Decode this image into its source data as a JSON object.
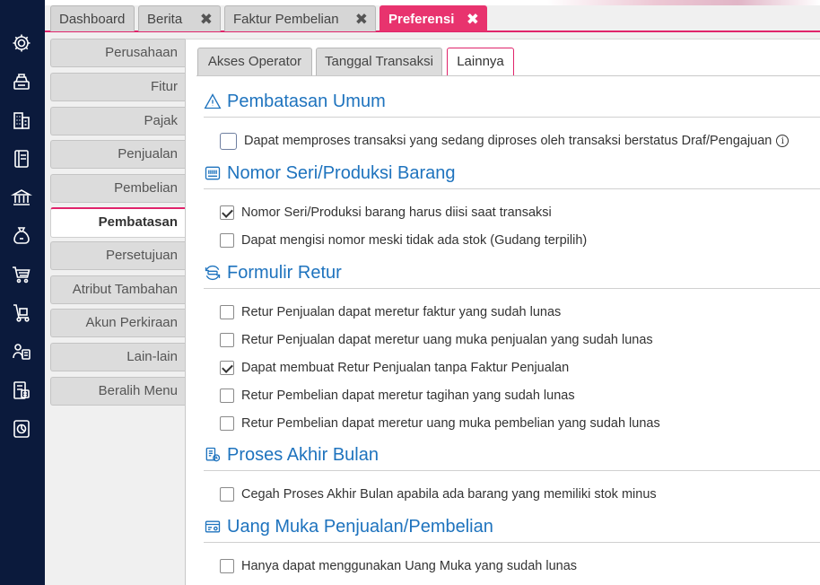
{
  "nav_icons": [
    "gear-icon",
    "cash-register-icon",
    "building-icon",
    "book-icon",
    "bank-icon",
    "money-bag-icon",
    "cart-icon",
    "hand-truck-icon",
    "accounting-icon",
    "tax-icon",
    "report-chart-icon"
  ],
  "tabs": [
    {
      "label": "Dashboard"
    },
    {
      "label": "Berita"
    },
    {
      "label": "Faktur Pembelian"
    },
    {
      "label": "Preferensi"
    }
  ],
  "close_glyph": "✖",
  "sidemenu": [
    {
      "label": "Perusahaan"
    },
    {
      "label": "Fitur"
    },
    {
      "label": "Pajak"
    },
    {
      "label": "Penjualan"
    },
    {
      "label": "Pembelian"
    },
    {
      "label": "Pembatasan"
    },
    {
      "label": "Persetujuan"
    },
    {
      "label": "Atribut Tambahan"
    },
    {
      "label": "Akun Perkiraan"
    },
    {
      "label": "Lain-lain"
    },
    {
      "label": "Beralih Menu"
    }
  ],
  "subtabs": [
    {
      "label": "Akses Operator"
    },
    {
      "label": "Tanggal Transaksi"
    },
    {
      "label": "Lainnya"
    }
  ],
  "sections": [
    {
      "title": "Pembatasan Umum",
      "icon": "warning-icon",
      "options": [
        {
          "label": "Dapat memproses transaksi yang sedang diproses oleh transaksi berstatus Draf/Pengajuan",
          "checked": false
        }
      ]
    },
    {
      "title": "Nomor Seri/Produksi Barang",
      "icon": "barcode-icon",
      "options": [
        {
          "label": "Nomor Seri/Produksi barang harus diisi saat transaksi",
          "checked": true
        },
        {
          "label": "Dapat mengisi nomor meski tidak ada stok (Gudang terpilih)",
          "checked": false
        }
      ]
    },
    {
      "title": "Formulir Retur",
      "icon": "return-icon",
      "options": [
        {
          "label": "Retur Penjualan dapat meretur faktur yang sudah lunas",
          "checked": false
        },
        {
          "label": "Retur Penjualan dapat meretur uang muka penjualan yang sudah lunas",
          "checked": false
        },
        {
          "label": "Dapat membuat Retur Penjualan tanpa Faktur Penjualan",
          "checked": true
        },
        {
          "label": "Retur Pembelian dapat meretur tagihan yang sudah lunas",
          "checked": false
        },
        {
          "label": "Retur Pembelian dapat meretur uang muka pembelian yang sudah lunas",
          "checked": false
        }
      ]
    },
    {
      "title": "Proses Akhir Bulan",
      "icon": "month-end-icon",
      "options": [
        {
          "label": "Cegah Proses Akhir Bulan apabila ada barang yang memiliki stok minus",
          "checked": false
        }
      ]
    },
    {
      "title": "Uang Muka Penjualan/Pembelian",
      "icon": "down-payment-icon",
      "options": [
        {
          "label": "Hanya dapat menggunakan Uang Muka yang sudah lunas",
          "checked": false
        }
      ]
    }
  ],
  "info_glyph": "i",
  "colors": {
    "accent": "#e8336e",
    "nav_bg": "#0b1a3c",
    "section_title": "#1e73be"
  }
}
